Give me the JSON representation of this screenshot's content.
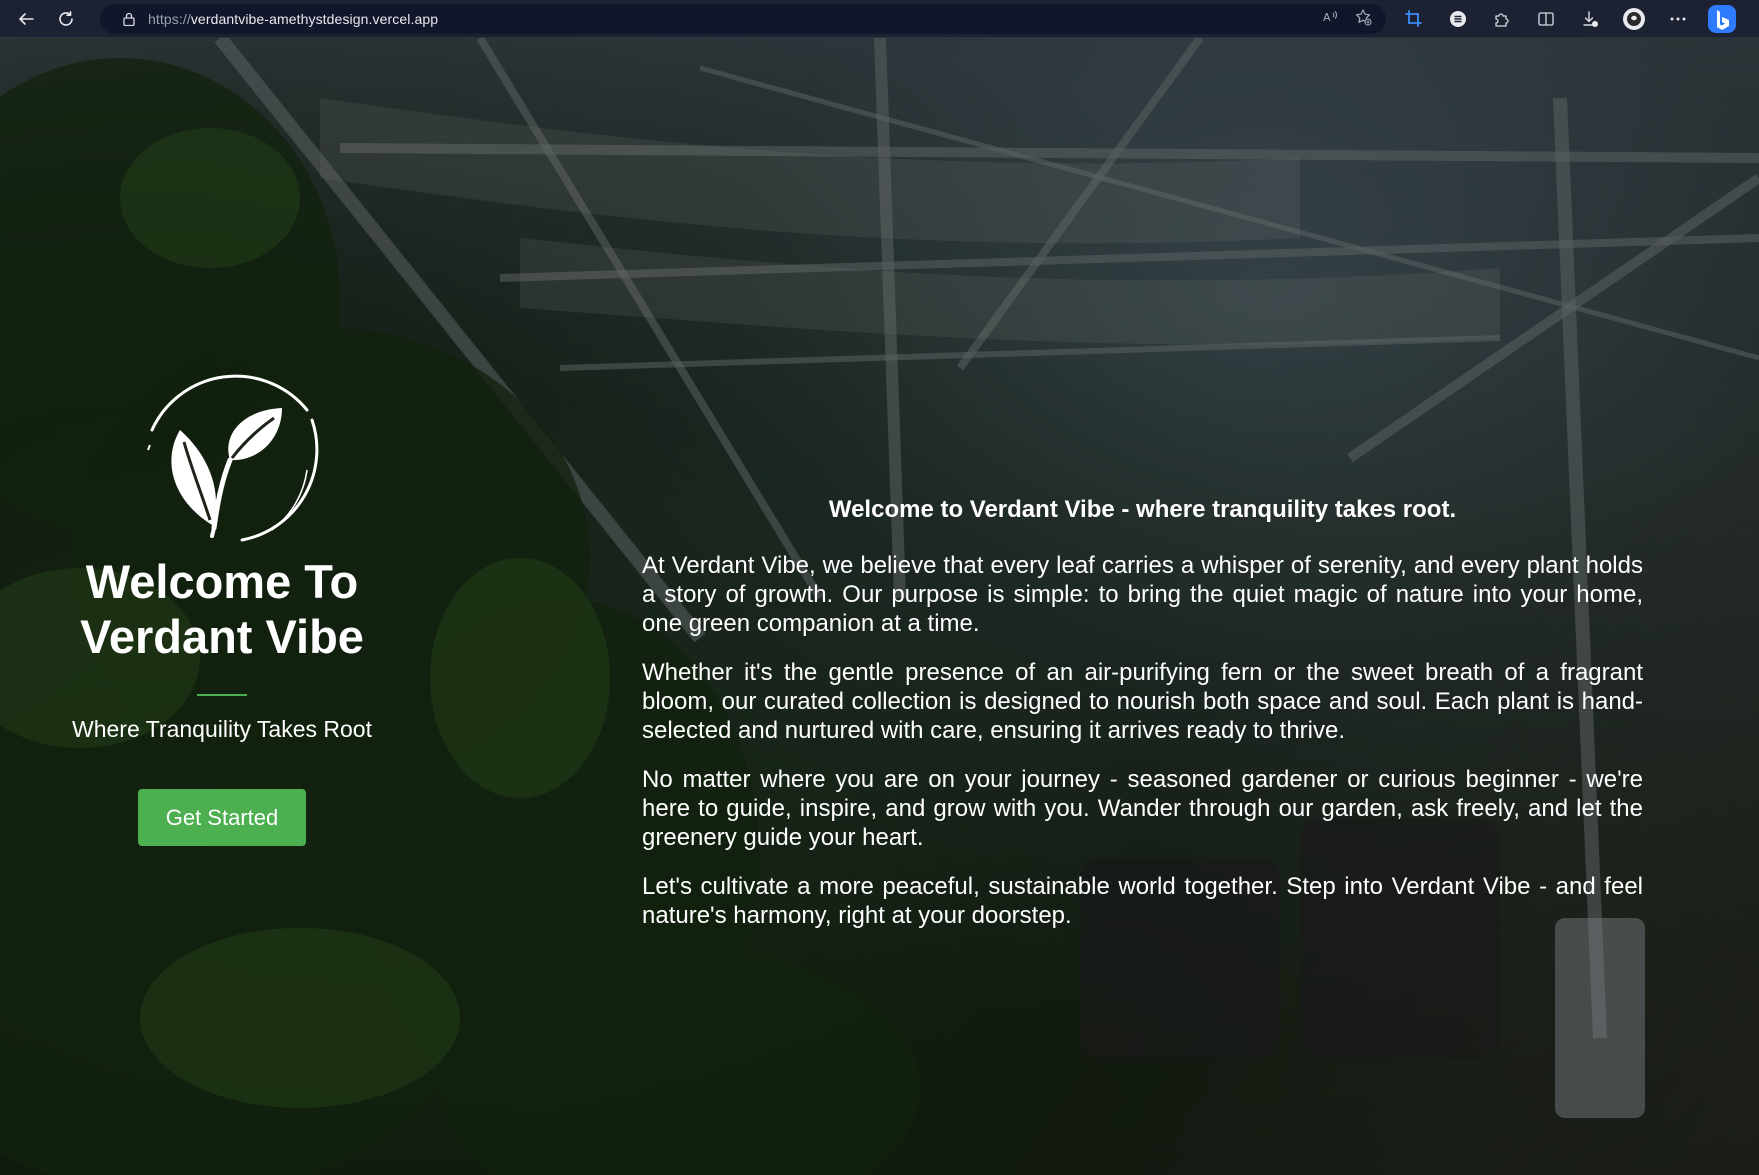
{
  "browser": {
    "url_scheme": "https://",
    "url_host": "verdantvibe-amethystdesign.vercel.app",
    "nav_icons": [
      "back-arrow-icon",
      "refresh-icon"
    ],
    "address_icons": [
      "read-aloud-icon",
      "add-favorite-icon"
    ],
    "toolbar_icons": [
      "screenshot-icon",
      "menu-circle-icon",
      "extensions-icon",
      "split-screen-icon",
      "downloads-icon",
      "profile-icon",
      "more-options-icon",
      "bing-copilot-icon"
    ],
    "accent_color": "#3b8cff"
  },
  "hero": {
    "logo_icon": "leaf-sprout-icon",
    "title_line1": "Welcome To",
    "title_line2": "Verdant Vibe",
    "tagline": "Where Tranquility Takes Root",
    "cta_label": "Get Started",
    "accent_color": "#4caf50"
  },
  "about": {
    "intro": "Welcome to Verdant Vibe - where tranquility takes root.",
    "paragraphs": [
      "At Verdant Vibe, we believe that every leaf carries a whisper of serenity, and every plant holds a story of growth. Our purpose is simple: to bring the quiet magic of nature into your home, one green companion at a time.",
      "Whether it's the gentle presence of an air-purifying fern or the sweet breath of a fragrant bloom, our curated collection is designed to nourish both space and soul. Each plant is hand-selected and nurtured with care, ensuring it arrives ready to thrive.",
      "No matter where you are on your journey - seasoned gardener or curious beginner - we're here to guide, inspire, and grow with you. Wander through our garden, ask freely, and let the greenery guide your heart.",
      "Let's cultivate a more peaceful, sustainable world together. Step into Verdant Vibe - and feel nature's harmony, right at your doorstep."
    ]
  }
}
